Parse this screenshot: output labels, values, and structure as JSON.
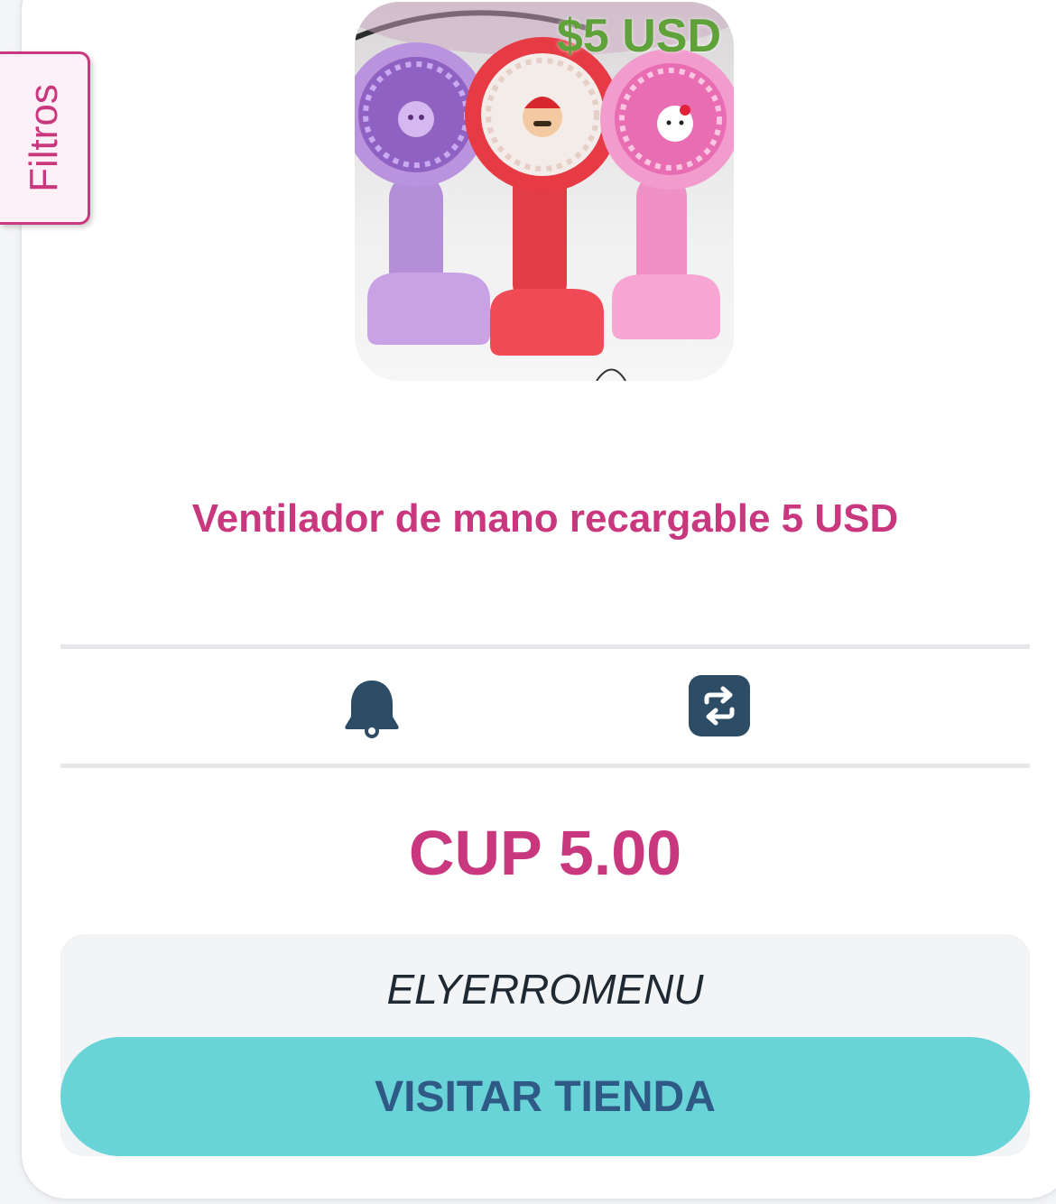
{
  "filters": {
    "label": "Filtros"
  },
  "product": {
    "image_alt": "Ventiladores de mano",
    "price_overlay": "$5 USD",
    "title": "Ventilador de mano recargable 5 USD",
    "price": "CUP 5.00"
  },
  "actions": [
    {
      "icon": "bell-icon"
    },
    {
      "icon": "repeat-icon"
    }
  ],
  "store": {
    "name": "ELYERROMENU",
    "button_label": "VISITAR TIENDA"
  },
  "colors": {
    "accent": "#c9377e",
    "price_overlay": "#5fa23a",
    "button_bg": "#68d4d8",
    "button_text": "#2e5a85",
    "icon": "#2d4d66"
  }
}
